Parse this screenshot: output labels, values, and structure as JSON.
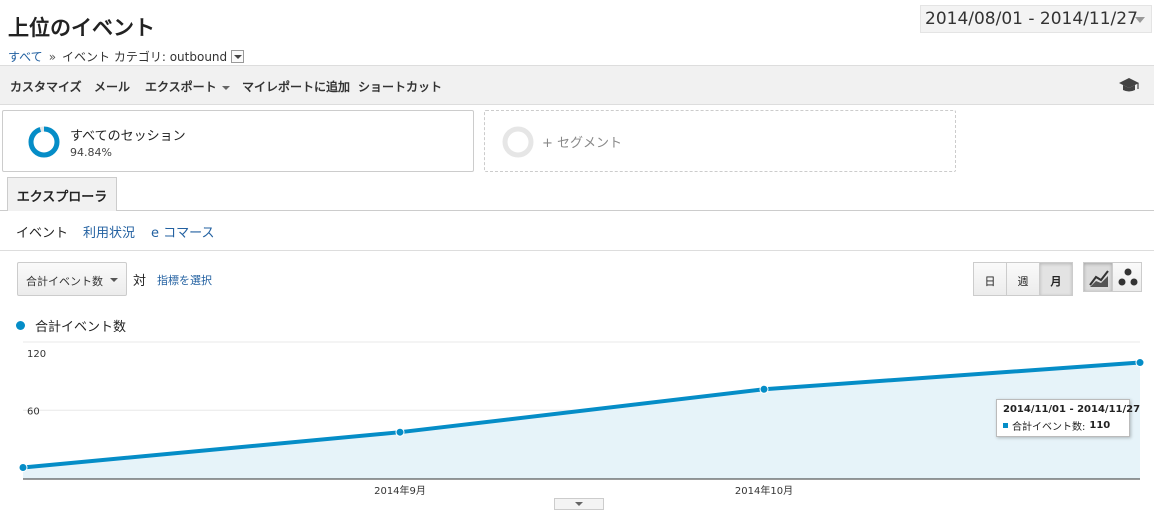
{
  "page": {
    "title": "上位のイベント",
    "date_range": "2014/08/01 - 2014/11/27"
  },
  "breadcrumb": {
    "root": "すべて",
    "separator": "»",
    "current": "イベント カテゴリ: outbound"
  },
  "toolbar": {
    "customize": "カスタマイズ",
    "email": "メール",
    "export": "エクスポート",
    "add_to_dashboard": "マイレポートに追加",
    "shortcut": "ショートカット",
    "help_icon": "graduation-cap-icon"
  },
  "segments": [
    {
      "name": "すべてのセッション",
      "percent": "94.84%",
      "fraction": 0.9484
    },
    {
      "name": "+ セグメント"
    }
  ],
  "tabs": {
    "explorer": "エクスプローラ"
  },
  "subnav": {
    "events": "イベント",
    "usage": "利用状況",
    "ecommerce": "e コマース"
  },
  "chart_controls": {
    "metric": "合計イベント数",
    "vs": "対",
    "select_metric": "指標を選択",
    "day": "日",
    "week": "週",
    "month": "月",
    "selected_granularity": "月",
    "line_chart_icon": "line-chart-icon",
    "motion_chart_icon": "motion-chart-icon"
  },
  "legend": {
    "series": "合計イベント数"
  },
  "tooltip": {
    "range": "2014/11/01 - 2014/11/27",
    "label": "合計イベント数:",
    "value": "110"
  },
  "colors": {
    "series": "#058dc7",
    "fill": "#e6f3f9",
    "link": "#2361a1"
  },
  "chart_data": {
    "type": "area",
    "x": [
      "2014/08",
      "2014/09",
      "2014/10",
      "2014/11"
    ],
    "x_tick_labels": [
      "2014年9月",
      "2014年10月"
    ],
    "y_tick_labels": [
      "60",
      "120"
    ],
    "series": [
      {
        "name": "合計イベント数",
        "values": [
          0,
          37,
          82,
          110
        ]
      }
    ],
    "ylim": [
      0,
      120
    ],
    "grid": true
  }
}
